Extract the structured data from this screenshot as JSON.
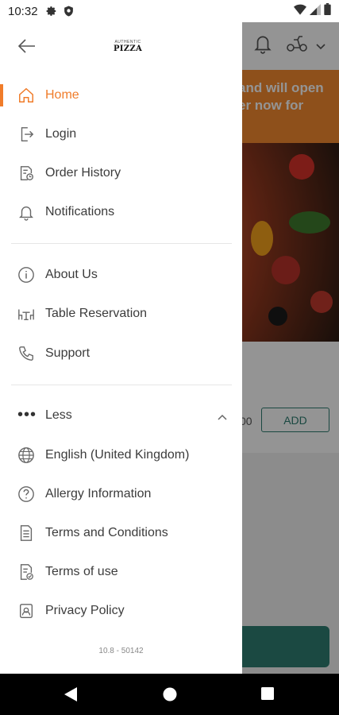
{
  "status_bar": {
    "time": "10:32"
  },
  "background": {
    "banner_lines": [
      "and will open",
      "er now for"
    ],
    "product_price": "00",
    "add_label": "ADD"
  },
  "drawer": {
    "logo": {
      "small": "AUTHENTIC",
      "main": "PIZZA"
    },
    "primary_items": [
      {
        "label": "Home",
        "icon": "home-icon",
        "active": true
      },
      {
        "label": "Login",
        "icon": "login-icon"
      },
      {
        "label": "Order History",
        "icon": "order-history-icon"
      },
      {
        "label": "Notifications",
        "icon": "bell-icon"
      }
    ],
    "secondary_items": [
      {
        "label": "About Us",
        "icon": "info-icon"
      },
      {
        "label": "Table Reservation",
        "icon": "table-icon"
      },
      {
        "label": "Support",
        "icon": "phone-icon"
      }
    ],
    "less_label": "Less",
    "extra_items": [
      {
        "label": "English (United Kingdom)",
        "icon": "globe-icon"
      },
      {
        "label": "Allergy Information",
        "icon": "question-icon"
      },
      {
        "label": "Terms and Conditions",
        "icon": "document-icon"
      },
      {
        "label": "Terms of use",
        "icon": "document-check-icon"
      },
      {
        "label": "Privacy Policy",
        "icon": "privacy-icon"
      }
    ],
    "version": "10.8 - 50142"
  },
  "colors": {
    "accent": "#f07c2a",
    "text": "#3c3c3c",
    "banner": "#f58a30",
    "teal": "#2f7e73"
  }
}
